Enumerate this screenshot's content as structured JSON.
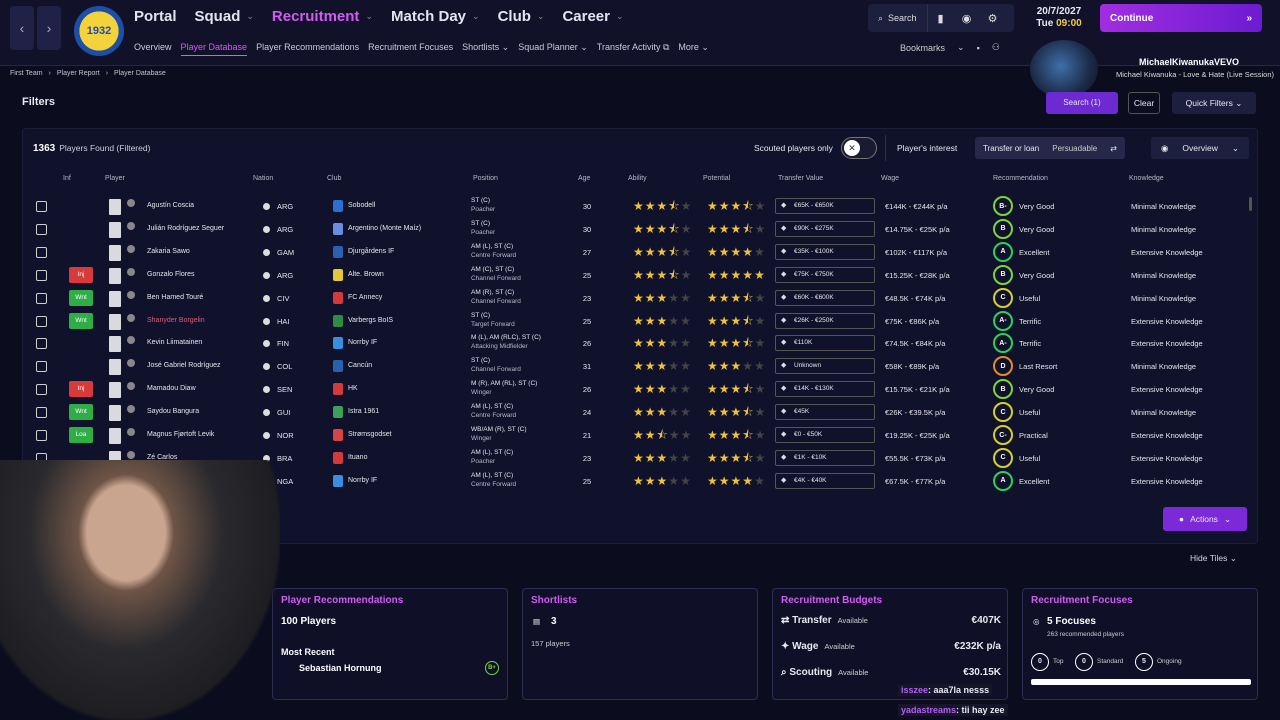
{
  "topbar": {
    "main_nav": [
      {
        "label": "Portal",
        "active": false
      },
      {
        "label": "Squad",
        "active": false
      },
      {
        "label": "Recruitment",
        "active": true
      },
      {
        "label": "Match Day",
        "active": false
      },
      {
        "label": "Club",
        "active": false
      },
      {
        "label": "Career",
        "active": false
      }
    ],
    "sub_nav": [
      {
        "label": "Overview",
        "active": false
      },
      {
        "label": "Player Database",
        "active": true
      },
      {
        "label": "Player Recommendations",
        "active": false
      },
      {
        "label": "Recruitment Focuses",
        "active": false
      },
      {
        "label": "Shortlists ⌄",
        "active": false
      },
      {
        "label": "Squad Planner ⌄",
        "active": false
      },
      {
        "label": "Transfer Activity ⧉",
        "active": false
      },
      {
        "label": "More ⌄",
        "active": false
      }
    ],
    "search_label": "Search",
    "date": "20/7/2027",
    "day": "Tue",
    "time": "09:00",
    "continue_label": "Continue",
    "bookmarks_label": "Bookmarks",
    "logo_text": "1932"
  },
  "music": {
    "artist": "MichaelKiwanukaVEVO",
    "song": "Michael Kiwanuka - Love & Hate (Live Session)"
  },
  "breadcrumb": [
    "First Team",
    "Player Report",
    "Player Database"
  ],
  "filters_label": "Filters",
  "search_btn": "Search (1)",
  "clear_btn": "Clear",
  "quick_filters": "Quick Filters",
  "panel": {
    "count": "1363",
    "count_label": "Players Found (Filtered)",
    "scouted_label": "Scouted players only",
    "interest_label": "Player's interest",
    "interest_type": "Transfer or loan",
    "interest_value": "Persuadable",
    "view": "Overview"
  },
  "columns": [
    "Inf",
    "Player",
    "Nation",
    "Club",
    "Position",
    "Age",
    "Ability",
    "Potential",
    "Transfer Value",
    "Wage",
    "Recommendation",
    "Knowledge"
  ],
  "players": [
    {
      "inf": "",
      "name": "Agustín Coscia",
      "nation": "ARG",
      "club": "Sobodell",
      "club_color": "#2b6fd1",
      "pos": "ST (C)",
      "role": "Poacher",
      "age": "30",
      "ability": 3.5,
      "potential": 3.5,
      "tv": "€65K - €650K",
      "wage": "€144K - €244K p/a",
      "rec": "B-",
      "rec_color": "#7fd33a",
      "rec_text": "Very Good",
      "know": "Minimal Knowledge"
    },
    {
      "inf": "",
      "name": "Julián Rodríguez Seguer",
      "nation": "ARG",
      "club": "Argentino (Monte Maíz)",
      "club_color": "#6b8de0",
      "pos": "ST (C)",
      "role": "Poacher",
      "age": "30",
      "ability": 3.5,
      "potential": 3.5,
      "tv": "€90K - €275K",
      "wage": "€14.75K - €25K p/a",
      "rec": "B",
      "rec_color": "#7fd33a",
      "rec_text": "Very Good",
      "know": "Minimal Knowledge"
    },
    {
      "inf": "",
      "name": "Zakaria Sawo",
      "nation": "GAM",
      "club": "Djurgårdens IF",
      "club_color": "#2b5fb0",
      "pos": "AM (L), ST (C)",
      "role": "Centre Forward",
      "age": "27",
      "ability": 3.5,
      "potential": 4,
      "tv": "€35K - €100K",
      "wage": "€102K - €117K p/a",
      "rec": "A",
      "rec_color": "#2ecf5a",
      "rec_text": "Excellent",
      "know": "Extensive Knowledge"
    },
    {
      "inf": "Inj",
      "inf_color": "#d63a3a",
      "name": "Gonzalo Flores",
      "nation": "ARG",
      "club": "Alte. Brown",
      "club_color": "#e2c83a",
      "pos": "AM (C), ST (C)",
      "role": "Channel Forward",
      "age": "25",
      "ability": 3.5,
      "potential": 5,
      "tv": "€75K - €750K",
      "wage": "€15.25K - €28K p/a",
      "rec": "B",
      "rec_color": "#7fd33a",
      "rec_text": "Very Good",
      "know": "Minimal Knowledge"
    },
    {
      "inf": "Wnt",
      "inf_color": "#2fae48",
      "name": "Ben Hamed Touré",
      "nation": "CIV",
      "club": "FC Annecy",
      "club_color": "#d03b3b",
      "pos": "AM (R), ST (C)",
      "role": "Channel Forward",
      "age": "23",
      "ability": 3,
      "potential": 3.5,
      "tv": "€60K - €600K",
      "wage": "€48.5K - €74K p/a",
      "rec": "C",
      "rec_color": "#d6cf2c",
      "rec_text": "Useful",
      "know": "Minimal Knowledge"
    },
    {
      "inf": "Wnt",
      "inf_color": "#2fae48",
      "name": "Shanyder Borgelin",
      "highlight": true,
      "nation": "HAI",
      "club": "Varbergs BoIS",
      "club_color": "#2e8a44",
      "pos": "ST (C)",
      "role": "Target Forward",
      "age": "25",
      "ability": 3,
      "potential": 3.5,
      "tv": "€26K - €250K",
      "wage": "€75K - €86K p/a",
      "rec": "A-",
      "rec_color": "#2ecf5a",
      "rec_text": "Terrific",
      "know": "Extensive Knowledge"
    },
    {
      "inf": "",
      "name": "Kevin Liimatainen",
      "nation": "FIN",
      "club": "Norrby IF",
      "club_color": "#3a8ee0",
      "pos": "M (L), AM (RLC), ST (C)",
      "role": "Attacking Midfielder",
      "age": "26",
      "ability": 3,
      "potential": 3.5,
      "tv": "€110K",
      "wage": "€74.5K - €84K p/a",
      "rec": "A-",
      "rec_color": "#2ecf5a",
      "rec_text": "Terrific",
      "know": "Extensive Knowledge"
    },
    {
      "inf": "",
      "name": "José Gabriel Rodríguez",
      "nation": "COL",
      "club": "Cancún",
      "club_color": "#2a5fae",
      "pos": "ST (C)",
      "role": "Channel Forward",
      "age": "31",
      "ability": 3,
      "potential": 3,
      "tv": "Unknown",
      "wage": "€58K - €89K p/a",
      "rec": "D",
      "rec_color": "#e08d2a",
      "rec_text": "Last Resort",
      "know": "Minimal Knowledge"
    },
    {
      "inf": "Inj",
      "inf_color": "#d63a3a",
      "name": "Mamadou Diaw",
      "nation": "SEN",
      "club": "HK",
      "club_color": "#d03b3b",
      "pos": "M (R), AM (RL), ST (C)",
      "role": "Winger",
      "age": "26",
      "ability": 3,
      "potential": 3.5,
      "tv": "€14K - €130K",
      "wage": "€15.75K - €21K p/a",
      "rec": "B",
      "rec_color": "#7fd33a",
      "rec_text": "Very Good",
      "know": "Extensive Knowledge"
    },
    {
      "inf": "Wnt",
      "inf_color": "#2fae48",
      "name": "Saydou Bangura",
      "nation": "GUI",
      "club": "Istra 1961",
      "club_color": "#3aa05a",
      "pos": "AM (L), ST (C)",
      "role": "Centre Forward",
      "age": "24",
      "ability": 3,
      "potential": 3.5,
      "tv": "€45K",
      "wage": "€26K - €39.5K p/a",
      "rec": "C",
      "rec_color": "#d6cf2c",
      "rec_text": "Useful",
      "know": "Minimal Knowledge"
    },
    {
      "inf": "Loa",
      "inf_color": "#2fae48",
      "name": "Magnus Fjørtoft Levik",
      "nation": "NOR",
      "club": "Strømsgodset",
      "club_color": "#d64545",
      "pos": "WB/AM (R), ST (C)",
      "role": "Winger",
      "age": "21",
      "ability": 2.5,
      "potential": 3.5,
      "tv": "€0 - €50K",
      "wage": "€19.25K - €25K p/a",
      "rec": "C-",
      "rec_color": "#d6cf2c",
      "rec_text": "Practical",
      "know": "Extensive Knowledge"
    },
    {
      "inf": "",
      "name": "Zé Carlos",
      "nation": "BRA",
      "club": "Ituano",
      "club_color": "#d03b3b",
      "pos": "AM (L), ST (C)",
      "role": "Poacher",
      "age": "23",
      "ability": 3,
      "potential": 3.5,
      "tv": "€1K - €10K",
      "wage": "€55.5K - €73K p/a",
      "rec": "C",
      "rec_color": "#d6cf2c",
      "rec_text": "Useful",
      "know": "Extensive Knowledge"
    },
    {
      "inf": "",
      "name": "",
      "nation": "NGA",
      "club": "Norrby IF",
      "club_color": "#3a8ee0",
      "pos": "AM (L), ST (C)",
      "role": "Centre Forward",
      "age": "25",
      "ability": 3,
      "potential": 4,
      "tv": "€4K - €40K",
      "wage": "€67.5K - €77K p/a",
      "rec": "A",
      "rec_color": "#2ecf5a",
      "rec_text": "Excellent",
      "know": "Extensive Knowledge"
    }
  ],
  "actions_label": "Actions",
  "hide_tiles": "Hide Tiles",
  "tiles": {
    "rec": {
      "title": "Player Recommendations",
      "big": "100 Players",
      "recent_label": "Most Recent",
      "recent_name": "Sebastian Hornung",
      "recent_grade": "B+"
    },
    "short": {
      "title": "Shortlists",
      "big": "3",
      "sub": "157 players"
    },
    "budget": {
      "title": "Recruitment Budgets",
      "rows": [
        {
          "name": "Transfer",
          "available": "Available",
          "amount": "€407K"
        },
        {
          "name": "Wage",
          "available": "Available",
          "amount": "€232K p/a"
        },
        {
          "name": "Scouting",
          "available": "Available",
          "amount": "€30.15K"
        }
      ]
    },
    "focus": {
      "title": "Recruitment Focuses",
      "big": "5 Focuses",
      "sub": "263 recommended players",
      "top": "0",
      "top_label": "Top",
      "std": "0",
      "std_label": "Standard",
      "ong": "5",
      "ong_label": "Ongoing"
    }
  },
  "chat": [
    {
      "user": "isszee",
      "msg": ": aaa7la nesss"
    },
    {
      "user": "yadastreams",
      "msg": ": tii hay zee"
    }
  ]
}
